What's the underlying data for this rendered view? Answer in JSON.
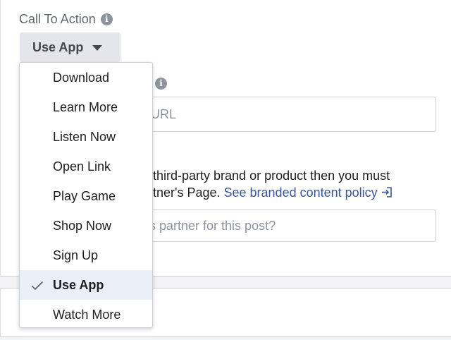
{
  "cta": {
    "label": "Call To Action",
    "info_glyph": "i",
    "selected_value": "Use App"
  },
  "url_field": {
    "placeholder": "URL"
  },
  "branded": {
    "line1": "third-party brand or product then you must",
    "line2_prefix": "tner's Page. ",
    "policy_link": "See branded content policy"
  },
  "partner_field": {
    "placeholder": "s partner for this post?"
  },
  "dropdown": {
    "options": [
      {
        "label": "Download"
      },
      {
        "label": "Learn More"
      },
      {
        "label": "Listen Now"
      },
      {
        "label": "Open Link"
      },
      {
        "label": "Play Game"
      },
      {
        "label": "Shop Now"
      },
      {
        "label": "Sign Up"
      },
      {
        "label": "Use App",
        "selected": true
      },
      {
        "label": "Watch More"
      }
    ]
  },
  "icons": {
    "info": "info-icon",
    "caret": "caret-down-icon",
    "external": "external-link-icon",
    "check": "check-icon"
  },
  "colors": {
    "link": "#385898",
    "selected_bg": "#ebf0f8",
    "button_bg": "#e4e6eb"
  }
}
